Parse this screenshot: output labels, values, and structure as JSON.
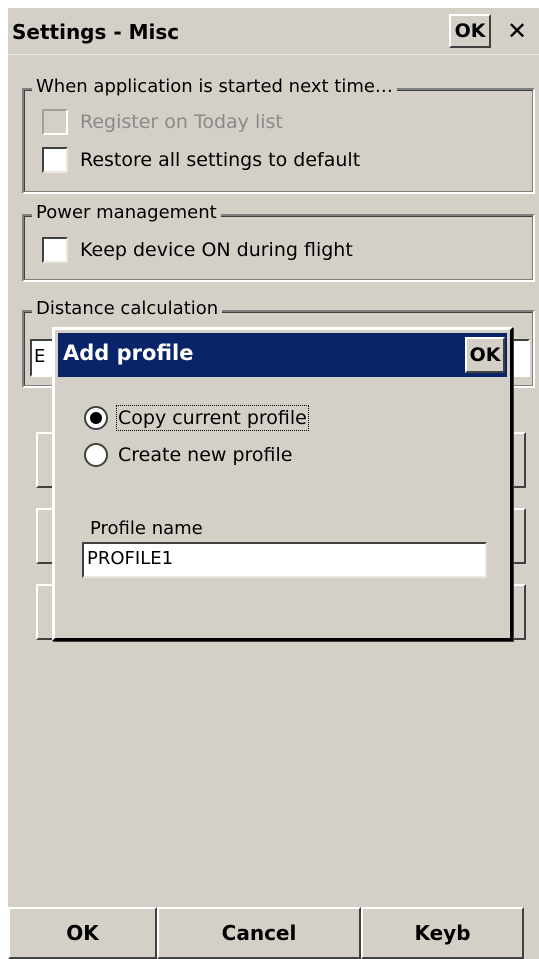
{
  "window": {
    "title": "Settings - Misc",
    "ok_label": "OK",
    "close_glyph": "✕"
  },
  "groups": {
    "startup": {
      "title": "When application is started next time…",
      "items": [
        {
          "label": "Register on Today list",
          "checked": false,
          "disabled": true
        },
        {
          "label": "Restore all settings to default",
          "checked": false,
          "disabled": false
        }
      ]
    },
    "power": {
      "title": "Power management",
      "items": [
        {
          "label": "Keep device ON during flight",
          "checked": false,
          "disabled": false
        }
      ]
    },
    "distance": {
      "title": "Distance calculation",
      "value_partial": "E"
    }
  },
  "dialog": {
    "title": "Add profile",
    "ok_label": "OK",
    "options": [
      {
        "label": "Copy current profile",
        "selected": true
      },
      {
        "label": "Create new profile",
        "selected": false
      }
    ],
    "profile_name_label": "Profile name",
    "profile_name_value": "PROFILE1"
  },
  "bottom_bar": {
    "ok": "OK",
    "cancel": "Cancel",
    "keyb": "Keyb"
  }
}
